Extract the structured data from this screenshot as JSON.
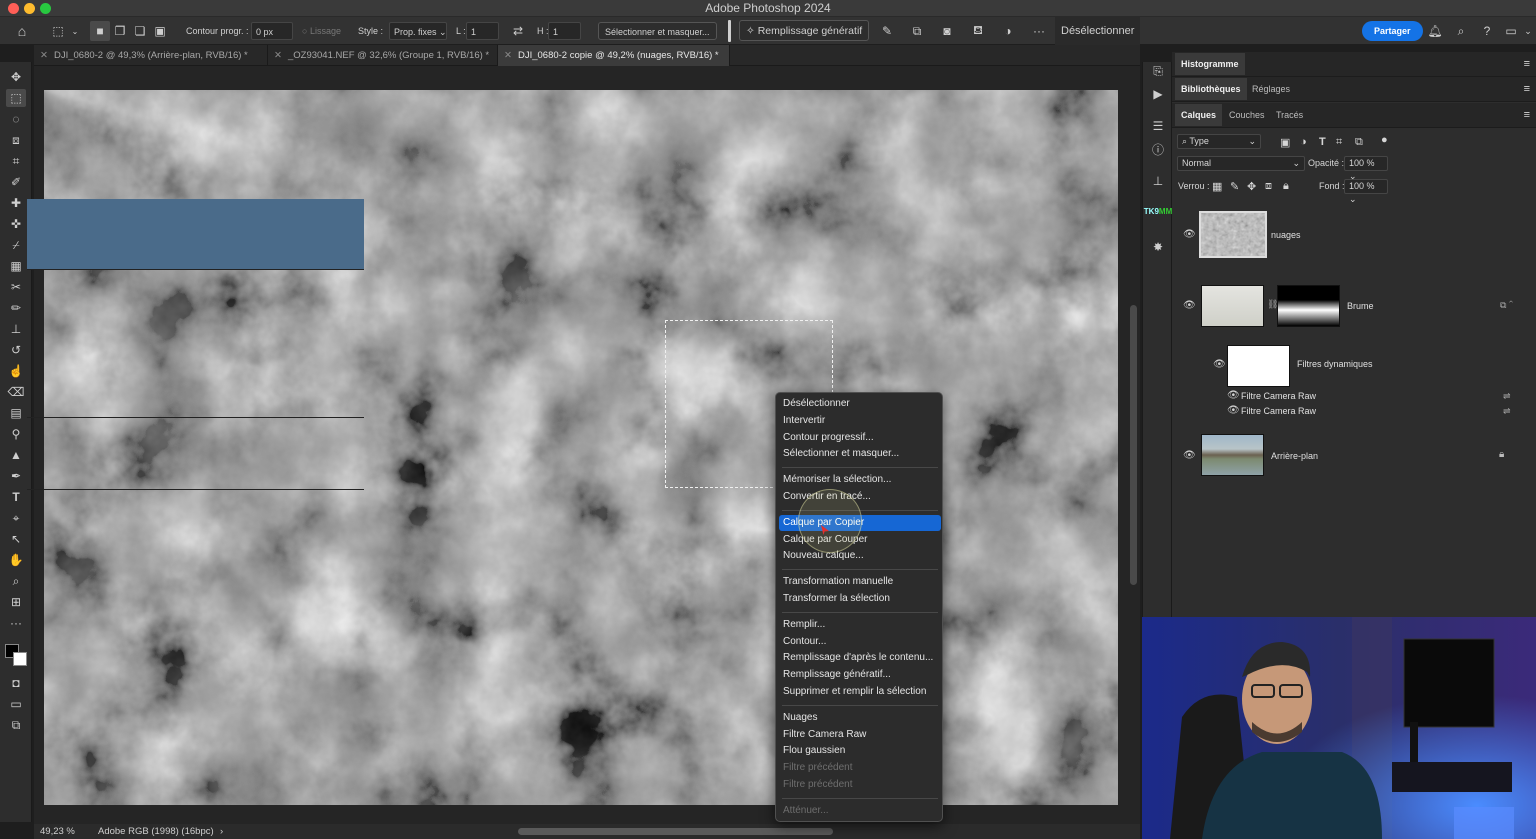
{
  "app": {
    "title": "Adobe Photoshop 2024",
    "traffic_colors": [
      "#ff5f57",
      "#febc2e",
      "#28c840"
    ]
  },
  "options_bar": {
    "feather_label": "Contour progr. :",
    "feather_value": "0 px",
    "antialias_label": "Lissage",
    "style_label": "Style :",
    "style_value": "Prop. fixes",
    "width_label": "L :",
    "width_value": "1",
    "height_label": "H :",
    "height_value": "1",
    "select_mask_label": "Sélectionner et masquer...",
    "generative_fill_label": "Remplissage génératif",
    "deselect_label": "Désélectionner",
    "share_label": "Partager",
    "share_color": "#1473e6"
  },
  "tabs": [
    {
      "label": "DJI_0680-2 @ 49,3% (Arrière-plan, RVB/16) *",
      "active": false
    },
    {
      "label": "_OZ93041.NEF @ 32,6% (Groupe 1, RVB/16) *",
      "active": false
    },
    {
      "label": "DJI_0680-2 copie @ 49,2% (nuages, RVB/16) *",
      "active": true
    }
  ],
  "status": {
    "zoom": "49,23 %",
    "profile": "Adobe RGB (1998) (16bpc)"
  },
  "context_menu": {
    "items": [
      {
        "label": "Désélectionner",
        "state": "normal"
      },
      {
        "label": "Intervertir",
        "state": "normal"
      },
      {
        "label": "Contour progressif...",
        "state": "normal"
      },
      {
        "label": "Sélectionner et masquer...",
        "state": "normal"
      },
      {
        "label": "",
        "state": "separator"
      },
      {
        "label": "Mémoriser la sélection...",
        "state": "normal"
      },
      {
        "label": "Convertir en tracé...",
        "state": "normal"
      },
      {
        "label": "",
        "state": "separator"
      },
      {
        "label": "Calque par Copier",
        "state": "highlight"
      },
      {
        "label": "Calque par Couper",
        "state": "normal"
      },
      {
        "label": "Nouveau calque...",
        "state": "normal"
      },
      {
        "label": "",
        "state": "separator"
      },
      {
        "label": "Transformation manuelle",
        "state": "normal"
      },
      {
        "label": "Transformer la sélection",
        "state": "normal"
      },
      {
        "label": "",
        "state": "separator"
      },
      {
        "label": "Remplir...",
        "state": "normal"
      },
      {
        "label": "Contour...",
        "state": "normal"
      },
      {
        "label": "Remplissage d'après le contenu...",
        "state": "normal"
      },
      {
        "label": "Remplissage génératif...",
        "state": "normal"
      },
      {
        "label": "Supprimer et remplir la sélection",
        "state": "normal"
      },
      {
        "label": "",
        "state": "separator"
      },
      {
        "label": "Nuages",
        "state": "normal"
      },
      {
        "label": "Filtre Camera Raw",
        "state": "normal"
      },
      {
        "label": "Flou gaussien",
        "state": "normal"
      },
      {
        "label": "Filtre précédent",
        "state": "disabled"
      },
      {
        "label": "Filtre précédent",
        "state": "disabled"
      },
      {
        "label": "",
        "state": "separator"
      },
      {
        "label": "Atténuer...",
        "state": "disabled"
      }
    ],
    "highlight_color": "#1667d4"
  },
  "panels": {
    "histogram_tab": "Histogramme",
    "libraries_tab": "Bibliothèques",
    "adjustments_tab": "Réglages",
    "layers_tab": "Calques",
    "channels_tab": "Couches",
    "paths_tab": "Tracés",
    "filter_kind": "Type",
    "blend_mode": "Normal",
    "opacity_label": "Opacité :",
    "opacity_value": "100 %",
    "lock_label": "Verrou :",
    "fill_label": "Fond :",
    "fill_value": "100 %"
  },
  "layers": [
    {
      "name": "nuages",
      "selected": true
    },
    {
      "name": "Brume",
      "selected": false
    },
    {
      "name": "Filtres dynamiques",
      "selected": false
    },
    {
      "name": "Filtre Camera Raw",
      "selected": false
    },
    {
      "name": "Filtre Camera Raw",
      "selected": false
    },
    {
      "name": "Arrière-plan",
      "selected": false
    }
  ],
  "layer_selected_color": "#4a6b8a"
}
